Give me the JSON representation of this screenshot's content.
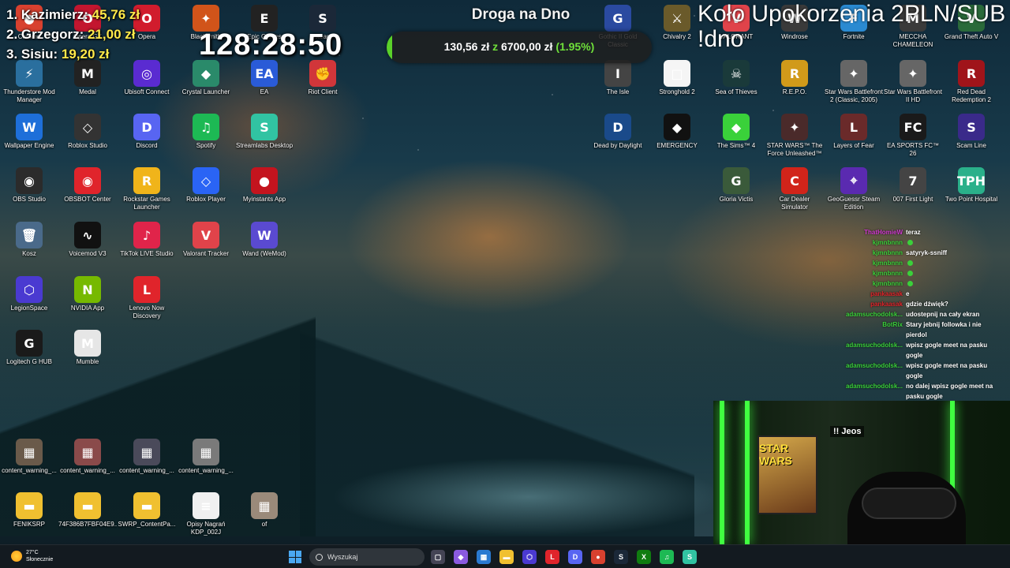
{
  "overlay": {
    "leaderboard": [
      {
        "rank_name": "1. Kazimierz:",
        "amount": "45,76 zł"
      },
      {
        "rank_name": "2. Grzegorz:",
        "amount": "21,00 zł"
      },
      {
        "rank_name": "3. Sisiu:",
        "amount": "19,20 zł"
      }
    ],
    "timer": "128:28:50",
    "goal": {
      "title": "Droga na Dno",
      "current": "130,56 zł",
      "sep": "z",
      "target": "6700,00 zł",
      "percent_text": "(1.95%)",
      "percent": 1.95
    },
    "wheel_title": "Koło Upokorzenia 2PLN/SUB",
    "wheel_command": "!dno",
    "webcam_label": "!! Jeos",
    "poster_text": "STAR WARS"
  },
  "desktop_left": [
    {
      "label": "Chrome",
      "glyph": "●",
      "color": "#d8412f"
    },
    {
      "label": "Opera GX",
      "glyph": "O",
      "color": "#c3162f"
    },
    {
      "label": "Opera",
      "glyph": "O",
      "color": "#d11c2d"
    },
    {
      "label": "Blacksmith",
      "glyph": "✦",
      "color": "#d1541a"
    },
    {
      "label": "Epic Games",
      "glyph": "E",
      "color": "#222"
    },
    {
      "label": "Steam",
      "glyph": "S",
      "color": "#1b2838"
    },
    {
      "label": "Thunderstore Mod Manager",
      "glyph": "⚡",
      "color": "#2a6f9e"
    },
    {
      "label": "Medal",
      "glyph": "M",
      "color": "#222"
    },
    {
      "label": "Ubisoft Connect",
      "glyph": "◎",
      "color": "#5a2bd1"
    },
    {
      "label": "Crystal Launcher",
      "glyph": "◆",
      "color": "#2a8a6a"
    },
    {
      "label": "EA",
      "glyph": "EA",
      "color": "#2a5bd7"
    },
    {
      "label": "Riot Client",
      "glyph": "✊",
      "color": "#d1363a"
    },
    {
      "label": "Wallpaper Engine",
      "glyph": "W",
      "color": "#1e6fd9"
    },
    {
      "label": "Roblox Studio",
      "glyph": "◇",
      "color": "#333"
    },
    {
      "label": "Discord",
      "glyph": "D",
      "color": "#5865f2"
    },
    {
      "label": "Spotify",
      "glyph": "♫",
      "color": "#1db954"
    },
    {
      "label": "Streamlabs Desktop",
      "glyph": "S",
      "color": "#31c3a2"
    },
    {
      "label": "OBS Studio",
      "glyph": "◉",
      "color": "#2b2b2b"
    },
    {
      "label": "OBSBOT Center",
      "glyph": "◉",
      "color": "#e0242b"
    },
    {
      "label": "Rockstar Games Launcher",
      "glyph": "R",
      "color": "#f0b41a"
    },
    {
      "label": "Roblox Player",
      "glyph": "◇",
      "color": "#2a64f5"
    },
    {
      "label": "Myinstants App",
      "glyph": "●",
      "color": "#c4141e"
    },
    {
      "label": "Kosz",
      "glyph": "🗑",
      "color": "#4a6a8a"
    },
    {
      "label": "Voicemod V3",
      "glyph": "∿",
      "color": "#111"
    },
    {
      "label": "TikTok LIVE Studio",
      "glyph": "♪",
      "color": "#e0244a"
    },
    {
      "label": "Valorant Tracker",
      "glyph": "V",
      "color": "#e0434a"
    },
    {
      "label": "Wand (WeMod)",
      "glyph": "W",
      "color": "#5a4ad1"
    },
    {
      "label": "LegionSpace",
      "glyph": "⬡",
      "color": "#4a3ad1"
    },
    {
      "label": "NVIDIA App",
      "glyph": "N",
      "color": "#76b900"
    },
    {
      "label": "Lenovo Now Discovery",
      "glyph": "L",
      "color": "#e0242b"
    },
    {
      "label": "Logitech G HUB",
      "glyph": "G",
      "color": "#1a1a1a"
    },
    {
      "label": "Mumble",
      "glyph": "M",
      "color": "#e6e6e6"
    }
  ],
  "desktop_right": [
    {
      "label": "Gothic II Gold Classic",
      "glyph": "G",
      "color": "#2a4aa0"
    },
    {
      "label": "Chivalry 2",
      "glyph": "⚔",
      "color": "#6a5a2a"
    },
    {
      "label": "VALORANT",
      "glyph": "V",
      "color": "#e0434a"
    },
    {
      "label": "Windrose",
      "glyph": "W",
      "color": "#3a3a3a"
    },
    {
      "label": "Fortnite",
      "glyph": "F",
      "color": "#2a8ad1"
    },
    {
      "label": "MECCHA CHAMELEON",
      "glyph": "M",
      "color": "#3a3a3a"
    },
    {
      "label": "Grand Theft Auto V",
      "glyph": "V",
      "color": "#2a6a3a"
    },
    {
      "label": "The Isle",
      "glyph": "I",
      "color": "#444"
    },
    {
      "label": "Stronghold 2",
      "glyph": "□",
      "color": "#f5f5f5"
    },
    {
      "label": "Sea of Thieves",
      "glyph": "☠",
      "color": "#1a3a3a"
    },
    {
      "label": "R.E.P.O.",
      "glyph": "R",
      "color": "#d19a1a"
    },
    {
      "label": "Star Wars Battlefront 2 (Classic, 2005)",
      "glyph": "✦",
      "color": "#666"
    },
    {
      "label": "Star Wars Battlefront II HD",
      "glyph": "✦",
      "color": "#666"
    },
    {
      "label": "Red Dead Redemption 2",
      "glyph": "R",
      "color": "#a0141a"
    },
    {
      "label": "Dead by Daylight",
      "glyph": "D",
      "color": "#1a4a8a"
    },
    {
      "label": "EMERGENCY",
      "glyph": "◆",
      "color": "#111"
    },
    {
      "label": "The Sims™ 4",
      "glyph": "◆",
      "color": "#3ad13a"
    },
    {
      "label": "STAR WARS™ The Force Unleashed™ ...",
      "glyph": "✦",
      "color": "#4a2a2a"
    },
    {
      "label": "Layers of Fear",
      "glyph": "L",
      "color": "#6a2a2a"
    },
    {
      "label": "EA SPORTS FC™ 26",
      "glyph": "FC",
      "color": "#1a1a1a"
    },
    {
      "label": "Scam Line",
      "glyph": "S",
      "color": "#3a2a8a"
    },
    {
      "label": "Gloria Victis",
      "glyph": "G",
      "color": "#3a5a3a"
    },
    {
      "label": "Car Dealer Simulator",
      "glyph": "C",
      "color": "#d1241a"
    },
    {
      "label": "GeoGuessr Steam Edition",
      "glyph": "⌖",
      "color": "#5a2ab0"
    },
    {
      "label": "007 First Light",
      "glyph": "7",
      "color": "#444"
    },
    {
      "label": "Two Point Hospital",
      "glyph": "TPH",
      "color": "#2ab08a"
    }
  ],
  "desktop_files": [
    {
      "label": "content_warning_...",
      "glyph": "▦",
      "color": "#6a5a4a"
    },
    {
      "label": "content_warning_...",
      "glyph": "▦",
      "color": "#8a4a4a"
    },
    {
      "label": "content_warning_...",
      "glyph": "▦",
      "color": "#4a4a5a"
    },
    {
      "label": "content_warning_...",
      "glyph": "▦",
      "color": "#7a7a7a"
    },
    {
      "label": "FENIKSRP",
      "glyph": "▬",
      "color": "#f0c030"
    },
    {
      "label": "74F386B7FBF04E9...",
      "glyph": "▬",
      "color": "#f0c030"
    },
    {
      "label": "SWRP_ContentPa...",
      "glyph": "▬",
      "color": "#f0c030"
    },
    {
      "label": "Opisy Nagrań KDP_002J",
      "glyph": "≡",
      "color": "#f0f0f0"
    },
    {
      "label": "of",
      "glyph": "▦",
      "color": "#9a8a7a"
    }
  ],
  "chat": [
    {
      "user": "ThatHomieW",
      "text": "teraz",
      "user_color": "#d13ad1",
      "dot": false
    },
    {
      "user": "kjmnbnnn",
      "text": "",
      "user_color": "#3ad13a",
      "dot": true
    },
    {
      "user": "kjmnbnnn",
      "text": "satyryk-ssniff",
      "user_color": "#3ad13a",
      "dot": false
    },
    {
      "user": "kjmnbnnn",
      "text": "",
      "user_color": "#3ad13a",
      "dot": true
    },
    {
      "user": "kjmnbnnn",
      "text": "",
      "user_color": "#3ad13a",
      "dot": true
    },
    {
      "user": "kjmnbnnn",
      "text": "",
      "user_color": "#3ad13a",
      "dot": true
    },
    {
      "user": "pankaasak",
      "text": "e",
      "user_color": "#e0242b",
      "dot": false
    },
    {
      "user": "pankaasak",
      "text": "gdzie dźwięk?",
      "user_color": "#e0242b",
      "dot": false
    },
    {
      "user": "adamsuchodolsk...",
      "text": "udostepnij na cały ekran",
      "user_color": "#3ad13a",
      "dot": false
    },
    {
      "user": "BotRix",
      "text": "Stary jebnij followka i nie",
      "user_color": "#3ad13a",
      "dot": false
    },
    {
      "user": "",
      "text": "pierdol",
      "user_color": "#3ad13a",
      "dot": false
    },
    {
      "user": "adamsuchodolsk...",
      "text": "wpisz gogle meet na pasku",
      "user_color": "#3ad13a",
      "dot": false
    },
    {
      "user": "",
      "text": "gogle",
      "user_color": "#3ad13a",
      "dot": false
    },
    {
      "user": "adamsuchodolsk...",
      "text": "wpisz gogle meet na pasku",
      "user_color": "#3ad13a",
      "dot": false
    },
    {
      "user": "",
      "text": "gogle",
      "user_color": "#3ad13a",
      "dot": false
    },
    {
      "user": "adamsuchodolsk...",
      "text": "no dalej wpisz gogle meet na",
      "user_color": "#3ad13a",
      "dot": false
    },
    {
      "user": "",
      "text": "pasku gogle",
      "user_color": "#3ad13a",
      "dot": false
    }
  ],
  "taskbar": {
    "weather_temp": "27°C",
    "weather_desc": "Słonecznie",
    "search_placeholder": "Wyszukaj",
    "apps": [
      {
        "name": "task-view-icon",
        "glyph": "▢",
        "color": "#445"
      },
      {
        "name": "copilot-icon",
        "glyph": "◆",
        "color": "#8a5ae0"
      },
      {
        "name": "store-icon",
        "glyph": "▦",
        "color": "#2a7ad1"
      },
      {
        "name": "file-explorer-icon",
        "glyph": "▬",
        "color": "#f0c030"
      },
      {
        "name": "legionspace-icon",
        "glyph": "⬡",
        "color": "#4a3ad1"
      },
      {
        "name": "lenovo-icon",
        "glyph": "L",
        "color": "#e0242b"
      },
      {
        "name": "discord-icon",
        "glyph": "D",
        "color": "#5865f2"
      },
      {
        "name": "chrome-icon",
        "glyph": "●",
        "color": "#d8412f"
      },
      {
        "name": "steam-icon",
        "glyph": "S",
        "color": "#1b2838"
      },
      {
        "name": "xbox-icon",
        "glyph": "X",
        "color": "#107c10"
      },
      {
        "name": "spotify-icon",
        "glyph": "♫",
        "color": "#1db954"
      },
      {
        "name": "streamlabs-icon",
        "glyph": "S",
        "color": "#31c3a2"
      }
    ]
  }
}
